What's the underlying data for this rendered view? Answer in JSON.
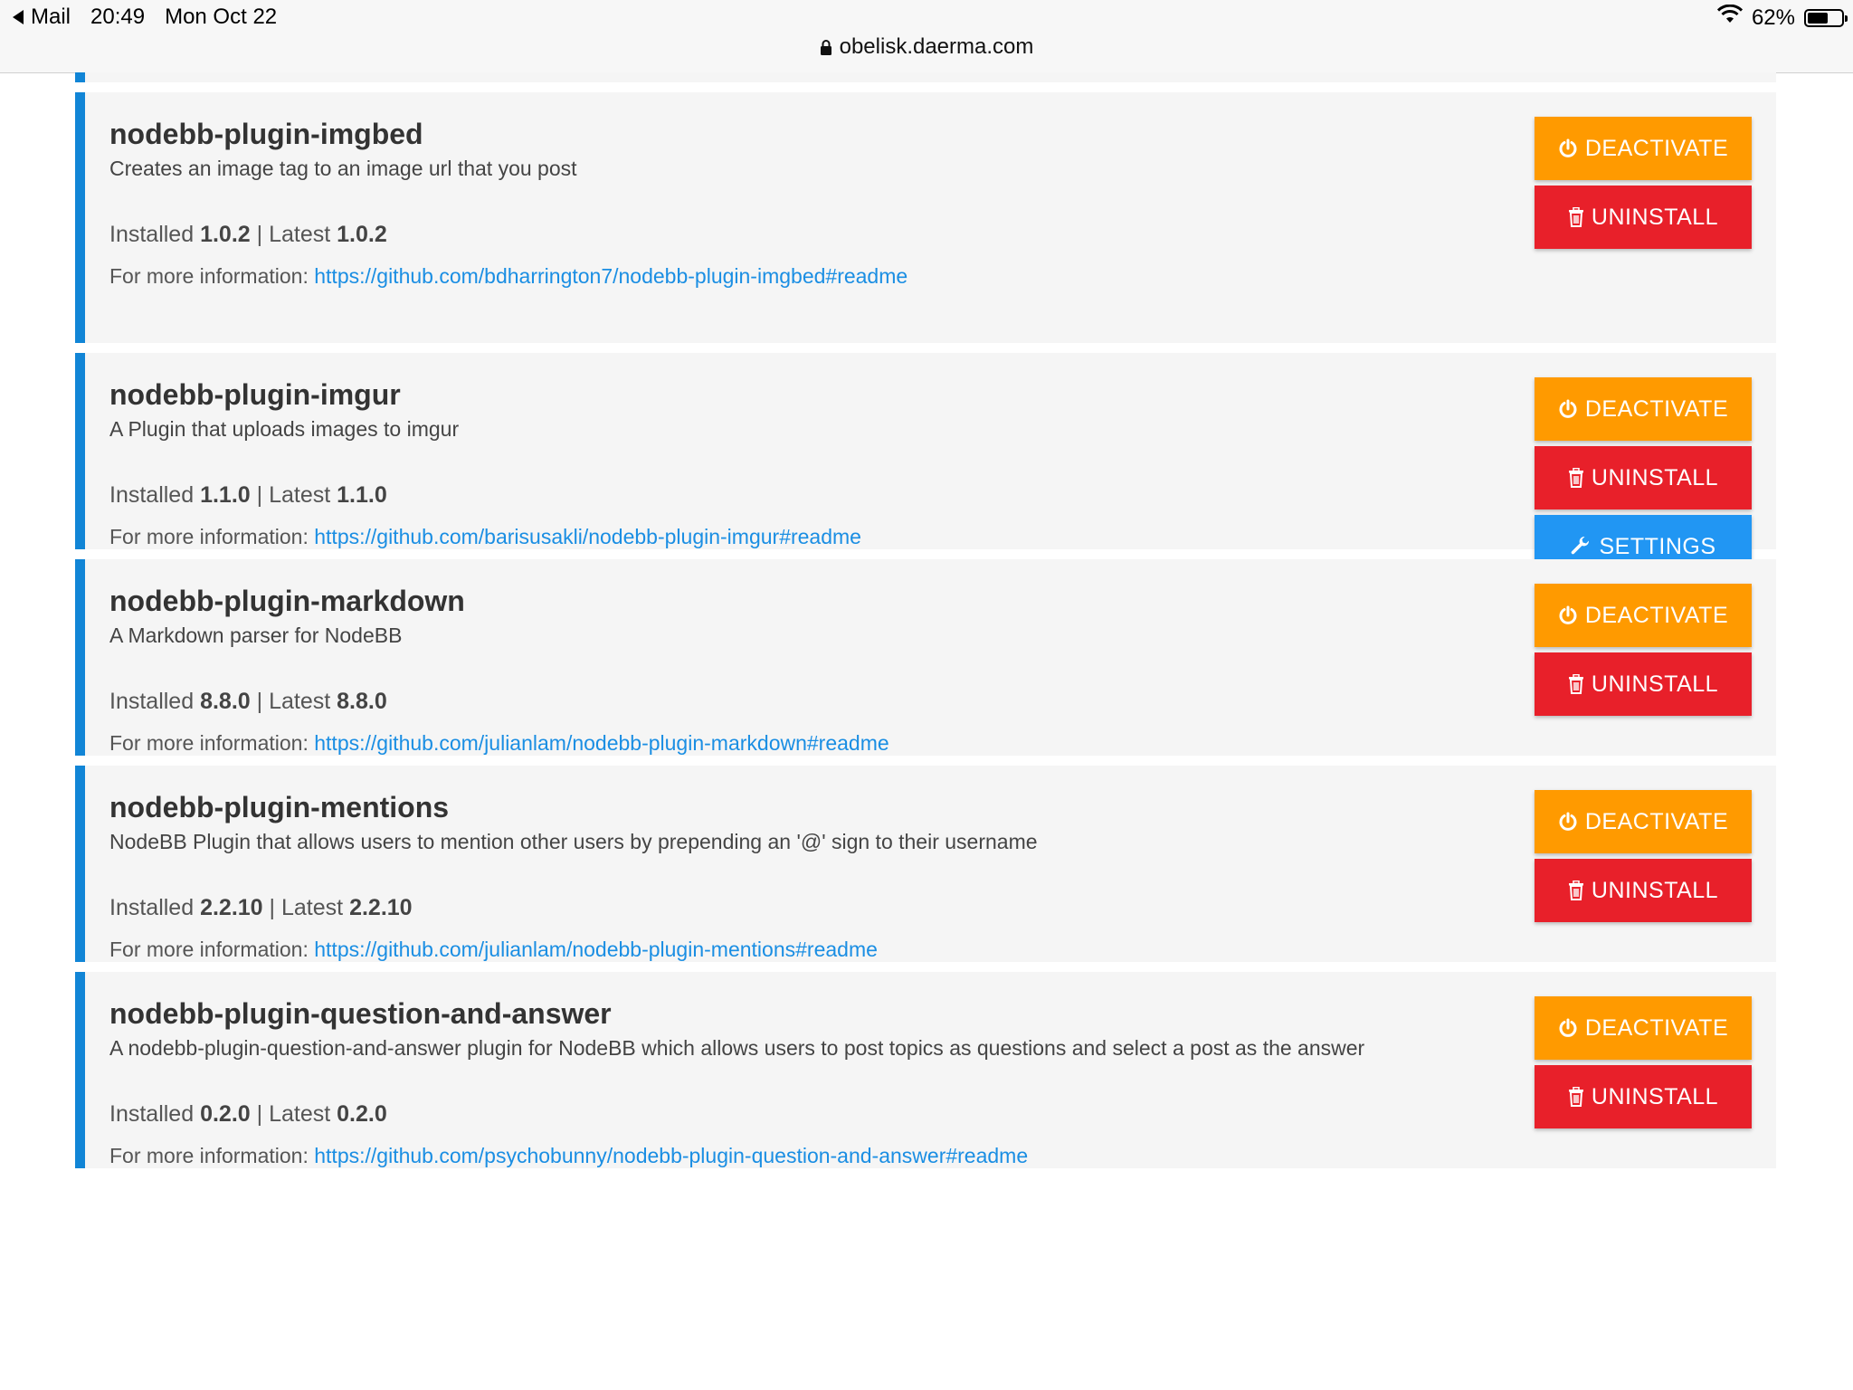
{
  "status_bar": {
    "back_app": "Mail",
    "time": "20:49",
    "date": "Mon Oct 22",
    "battery_percent": "62%",
    "battery_level": 0.62,
    "url": "obelisk.daerma.com"
  },
  "colors": {
    "accent_border": "#1185d6",
    "deactivate": "#ff9a00",
    "uninstall": "#e8202a",
    "settings": "#2196f3",
    "link": "#1a8ee3"
  },
  "labels": {
    "installed": "Installed",
    "latest": "Latest",
    "separator": "|",
    "more_info": "For more information:",
    "deactivate": "DEACTIVATE",
    "uninstall": "UNINSTALL",
    "settings": "SETTINGS"
  },
  "plugins": [
    {
      "name": "nodebb-plugin-imgbed",
      "description": "Creates an image tag to an image url that you post",
      "installed": "1.0.2",
      "latest": "1.0.2",
      "url": "https://github.com/bdharrington7/nodebb-plugin-imgbed#readme"
    },
    {
      "name": "nodebb-plugin-imgur",
      "description": "A Plugin that uploads images to imgur",
      "installed": "1.1.0",
      "latest": "1.1.0",
      "url": "https://github.com/barisusakli/nodebb-plugin-imgur#readme"
    },
    {
      "name": "nodebb-plugin-markdown",
      "description": "A Markdown parser for NodeBB",
      "installed": "8.8.0",
      "latest": "8.8.0",
      "url": "https://github.com/julianlam/nodebb-plugin-markdown#readme"
    },
    {
      "name": "nodebb-plugin-mentions",
      "description": "NodeBB Plugin that allows users to mention other users by prepending an '@' sign to their username",
      "installed": "2.2.10",
      "latest": "2.2.10",
      "url": "https://github.com/julianlam/nodebb-plugin-mentions#readme"
    },
    {
      "name": "nodebb-plugin-question-and-answer",
      "description": "A nodebb-plugin-question-and-answer plugin for NodeBB which allows users to post topics as questions and select a post as the answer",
      "installed": "0.2.0",
      "latest": "0.2.0",
      "url": "https://github.com/psychobunny/nodebb-plugin-question-and-answer#readme"
    }
  ],
  "icons": {
    "back": "back-triangle-icon",
    "wifi": "wifi-icon",
    "battery": "battery-icon",
    "lock": "lock-icon",
    "power": "power-icon",
    "trash": "trash-icon",
    "wrench": "wrench-icon"
  }
}
